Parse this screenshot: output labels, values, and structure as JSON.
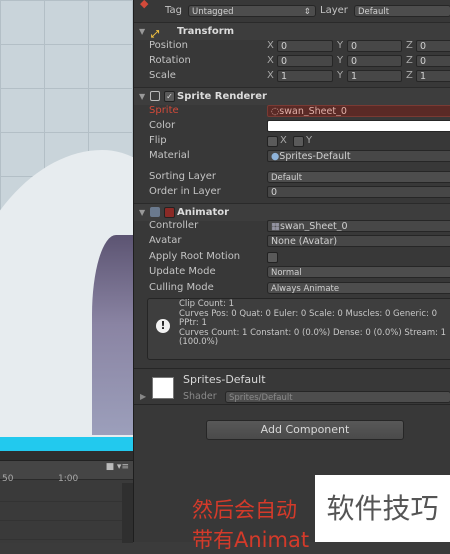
{
  "timeline": {
    "tick1": "50",
    "tick2": "1:00"
  },
  "header": {
    "tag_label": "Tag",
    "tag_value": "Untagged",
    "layer_label": "Layer",
    "layer_value": "Default"
  },
  "transform": {
    "title": "Transform",
    "position": {
      "label": "Position",
      "x": "0",
      "y": "0",
      "z": "0"
    },
    "rotation": {
      "label": "Rotation",
      "x": "0",
      "y": "0",
      "z": "0"
    },
    "scale": {
      "label": "Scale",
      "x": "1",
      "y": "1",
      "z": "1"
    },
    "axis": {
      "x": "X",
      "y": "Y",
      "z": "Z"
    }
  },
  "sprite_renderer": {
    "title": "Sprite Renderer",
    "sprite_label": "Sprite",
    "sprite_value": "swan_Sheet_0",
    "color_label": "Color",
    "flip_label": "Flip",
    "flip_x": "X",
    "flip_y": "Y",
    "material_label": "Material",
    "material_value": "Sprites-Default",
    "sorting_layer_label": "Sorting Layer",
    "sorting_layer_value": "Default",
    "order_label": "Order in Layer",
    "order_value": "0",
    "colors": {
      "sprite_missing": "#d24a3a",
      "color_swatch": "#ffffff"
    }
  },
  "animator": {
    "title": "Animator",
    "controller_label": "Controller",
    "controller_value": "swan_Sheet_0",
    "avatar_label": "Avatar",
    "avatar_value": "None (Avatar)",
    "root_motion_label": "Apply Root Motion",
    "update_mode_label": "Update Mode",
    "update_mode_value": "Normal",
    "culling_mode_label": "Culling Mode",
    "culling_mode_value": "Always Animate",
    "info": "Clip Count: 1\nCurves Pos: 0 Quat: 0 Euler: 0 Scale: 0 Muscles: 0 Generic: 0\nPPtr: 1\nCurves Count: 1 Constant: 0 (0.0%) Dense: 0 (0.0%) Stream: 1\n(100.0%)"
  },
  "material": {
    "name": "Sprites-Default",
    "shader_label": "Shader",
    "shader_value": "Sprites/Default"
  },
  "add_component": "Add Component",
  "caption": {
    "line1": "然后会自动",
    "line2": "带有Animat"
  },
  "watermark": "软件技巧",
  "colors": {
    "accent_cyan": "#22c9ee",
    "caption_red": "#d43a2a"
  }
}
